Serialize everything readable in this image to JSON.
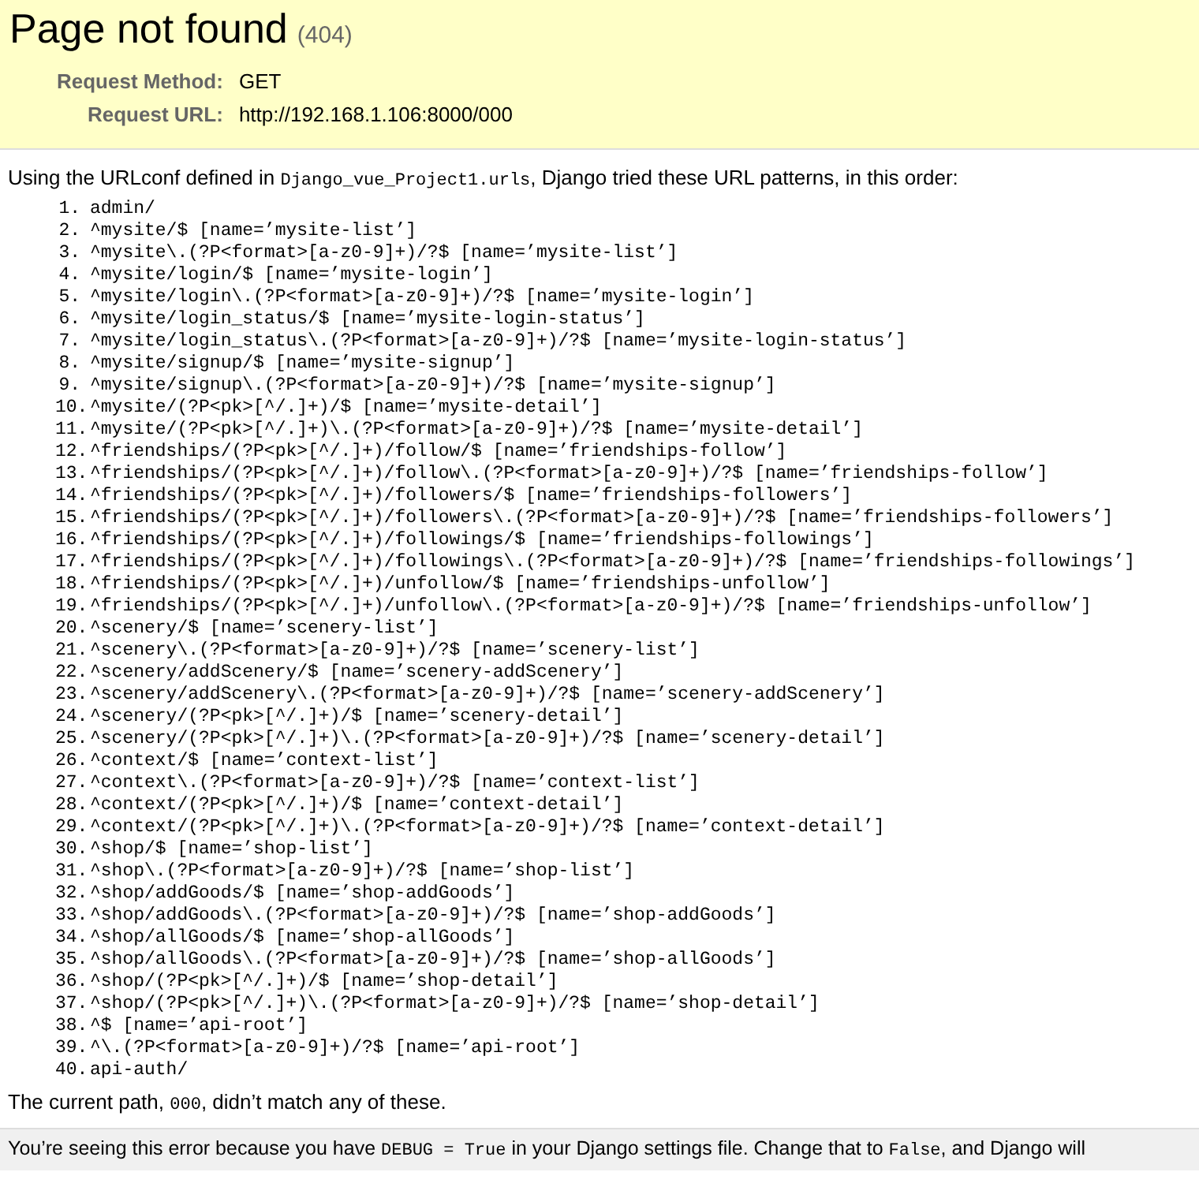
{
  "header": {
    "title": "Page not found",
    "code": "(404)",
    "details": [
      {
        "label": "Request Method:",
        "value": "GET"
      },
      {
        "label": "Request URL:",
        "value": "http://192.168.1.106:8000/000"
      }
    ]
  },
  "info": {
    "segments": [
      {
        "kind": "text",
        "text": "Using the URLconf defined in"
      },
      {
        "kind": "code",
        "text": "Django_vue_Project1.urls"
      },
      {
        "kind": "text",
        "text": ", Django tried these URL patterns, in this order:"
      }
    ]
  },
  "patterns": [
    {
      "number": "1.",
      "pattern": "admin/"
    },
    {
      "number": "2.",
      "pattern": "^mysite/$ [name=’mysite-list’]"
    },
    {
      "number": "3.",
      "pattern": "^mysite\\.(?P<format>[a-z0-9]+)/?$ [name=’mysite-list’]"
    },
    {
      "number": "4.",
      "pattern": "^mysite/login/$ [name=’mysite-login’]"
    },
    {
      "number": "5.",
      "pattern": "^mysite/login\\.(?P<format>[a-z0-9]+)/?$ [name=’mysite-login’]"
    },
    {
      "number": "6.",
      "pattern": "^mysite/login_status/$ [name=’mysite-login-status’]"
    },
    {
      "number": "7.",
      "pattern": "^mysite/login_status\\.(?P<format>[a-z0-9]+)/?$ [name=’mysite-login-status’]"
    },
    {
      "number": "8.",
      "pattern": "^mysite/signup/$ [name=’mysite-signup’]"
    },
    {
      "number": "9.",
      "pattern": "^mysite/signup\\.(?P<format>[a-z0-9]+)/?$ [name=’mysite-signup’]"
    },
    {
      "number": "10.",
      "pattern": "^mysite/(?P<pk>[^/.]+)/$ [name=’mysite-detail’]"
    },
    {
      "number": "11.",
      "pattern": "^mysite/(?P<pk>[^/.]+)\\.(?P<format>[a-z0-9]+)/?$ [name=’mysite-detail’]"
    },
    {
      "number": "12.",
      "pattern": "^friendships/(?P<pk>[^/.]+)/follow/$ [name=’friendships-follow’]"
    },
    {
      "number": "13.",
      "pattern": "^friendships/(?P<pk>[^/.]+)/follow\\.(?P<format>[a-z0-9]+)/?$ [name=’friendships-follow’]"
    },
    {
      "number": "14.",
      "pattern": "^friendships/(?P<pk>[^/.]+)/followers/$ [name=’friendships-followers’]"
    },
    {
      "number": "15.",
      "pattern": "^friendships/(?P<pk>[^/.]+)/followers\\.(?P<format>[a-z0-9]+)/?$ [name=’friendships-followers’]"
    },
    {
      "number": "16.",
      "pattern": "^friendships/(?P<pk>[^/.]+)/followings/$ [name=’friendships-followings’]"
    },
    {
      "number": "17.",
      "pattern": "^friendships/(?P<pk>[^/.]+)/followings\\.(?P<format>[a-z0-9]+)/?$ [name=’friendships-followings’]"
    },
    {
      "number": "18.",
      "pattern": "^friendships/(?P<pk>[^/.]+)/unfollow/$ [name=’friendships-unfollow’]"
    },
    {
      "number": "19.",
      "pattern": "^friendships/(?P<pk>[^/.]+)/unfollow\\.(?P<format>[a-z0-9]+)/?$ [name=’friendships-unfollow’]"
    },
    {
      "number": "20.",
      "pattern": "^scenery/$ [name=’scenery-list’]"
    },
    {
      "number": "21.",
      "pattern": "^scenery\\.(?P<format>[a-z0-9]+)/?$ [name=’scenery-list’]"
    },
    {
      "number": "22.",
      "pattern": "^scenery/addScenery/$ [name=’scenery-addScenery’]"
    },
    {
      "number": "23.",
      "pattern": "^scenery/addScenery\\.(?P<format>[a-z0-9]+)/?$ [name=’scenery-addScenery’]"
    },
    {
      "number": "24.",
      "pattern": "^scenery/(?P<pk>[^/.]+)/$ [name=’scenery-detail’]"
    },
    {
      "number": "25.",
      "pattern": "^scenery/(?P<pk>[^/.]+)\\.(?P<format>[a-z0-9]+)/?$ [name=’scenery-detail’]"
    },
    {
      "number": "26.",
      "pattern": "^context/$ [name=’context-list’]"
    },
    {
      "number": "27.",
      "pattern": "^context\\.(?P<format>[a-z0-9]+)/?$ [name=’context-list’]"
    },
    {
      "number": "28.",
      "pattern": "^context/(?P<pk>[^/.]+)/$ [name=’context-detail’]"
    },
    {
      "number": "29.",
      "pattern": "^context/(?P<pk>[^/.]+)\\.(?P<format>[a-z0-9]+)/?$ [name=’context-detail’]"
    },
    {
      "number": "30.",
      "pattern": "^shop/$ [name=’shop-list’]"
    },
    {
      "number": "31.",
      "pattern": "^shop\\.(?P<format>[a-z0-9]+)/?$ [name=’shop-list’]"
    },
    {
      "number": "32.",
      "pattern": "^shop/addGoods/$ [name=’shop-addGoods’]"
    },
    {
      "number": "33.",
      "pattern": "^shop/addGoods\\.(?P<format>[a-z0-9]+)/?$ [name=’shop-addGoods’]"
    },
    {
      "number": "34.",
      "pattern": "^shop/allGoods/$ [name=’shop-allGoods’]"
    },
    {
      "number": "35.",
      "pattern": "^shop/allGoods\\.(?P<format>[a-z0-9]+)/?$ [name=’shop-allGoods’]"
    },
    {
      "number": "36.",
      "pattern": "^shop/(?P<pk>[^/.]+)/$ [name=’shop-detail’]"
    },
    {
      "number": "37.",
      "pattern": "^shop/(?P<pk>[^/.]+)\\.(?P<format>[a-z0-9]+)/?$ [name=’shop-detail’]"
    },
    {
      "number": "38.",
      "pattern": "^$ [name=’api-root’]"
    },
    {
      "number": "39.",
      "pattern": "^\\.(?P<format>[a-z0-9]+)/?$ [name=’api-root’]"
    },
    {
      "number": "40.",
      "pattern": "api-auth/"
    }
  ],
  "result": {
    "segments": [
      {
        "kind": "text",
        "text": "The current path,"
      },
      {
        "kind": "code",
        "text": "000"
      },
      {
        "kind": "text",
        "text": ", didn’t match any of these."
      }
    ]
  },
  "footer": {
    "segments": [
      {
        "kind": "text",
        "text": "You’re seeing this error because you have"
      },
      {
        "kind": "code",
        "text": "DEBUG = True"
      },
      {
        "kind": "text",
        "text": "in your Django settings file. Change that to"
      },
      {
        "kind": "code",
        "text": "False"
      },
      {
        "kind": "text",
        "text": ", and Django will"
      }
    ]
  }
}
